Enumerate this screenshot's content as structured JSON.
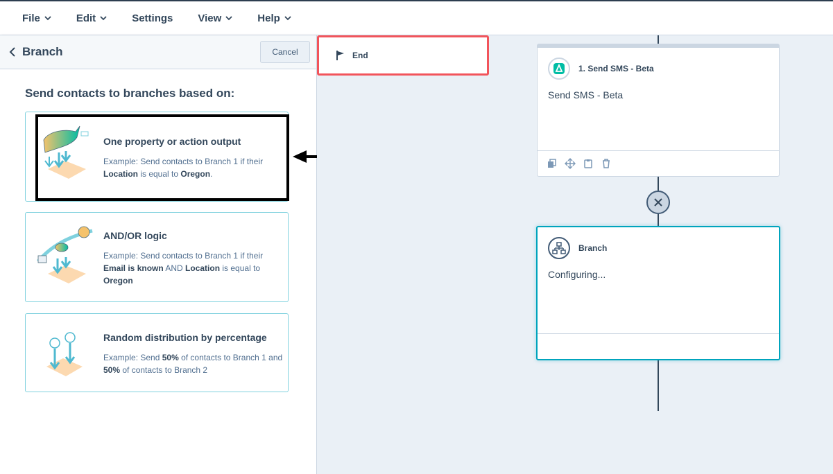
{
  "menu": {
    "items": [
      {
        "label": "File",
        "has_dropdown": true
      },
      {
        "label": "Edit",
        "has_dropdown": true
      },
      {
        "label": "Settings",
        "has_dropdown": false
      },
      {
        "label": "View",
        "has_dropdown": true
      },
      {
        "label": "Help",
        "has_dropdown": true
      }
    ]
  },
  "panel": {
    "title": "Branch",
    "cancel_label": "Cancel",
    "section_title": "Send contacts to branches based on:",
    "options": [
      {
        "title": "One property or action output",
        "desc_parts": [
          "Example: Send contacts to Branch 1 if their ",
          "Location",
          " is equal to ",
          "Oregon",
          "."
        ]
      },
      {
        "title": "AND/OR logic",
        "desc_parts": [
          "Example: Send contacts to Branch 1 if their ",
          "Email is known",
          " AND ",
          "Location",
          " is equal to ",
          "Oregon"
        ]
      },
      {
        "title": "Random distribution by percentage",
        "desc_parts": [
          "Example: Send ",
          "50%",
          " of contacts to Branch 1 and ",
          "50%",
          " of contacts to Branch 2"
        ]
      }
    ]
  },
  "workflow": {
    "sms_card": {
      "title": "1. Send SMS - Beta",
      "body": "Send SMS - Beta"
    },
    "branch_card": {
      "title": "Branch",
      "body": "Configuring..."
    },
    "end_card": {
      "label": "End"
    }
  },
  "colors": {
    "accent_teal": "#00a4bd",
    "end_border": "#f2545b",
    "highlight_box": "#000000",
    "canvas_bg": "#eaf0f6"
  },
  "icons": {
    "sms": "sms-icon",
    "branch": "branch-icon",
    "end": "flag-icon",
    "back": "chevron-left-icon"
  }
}
